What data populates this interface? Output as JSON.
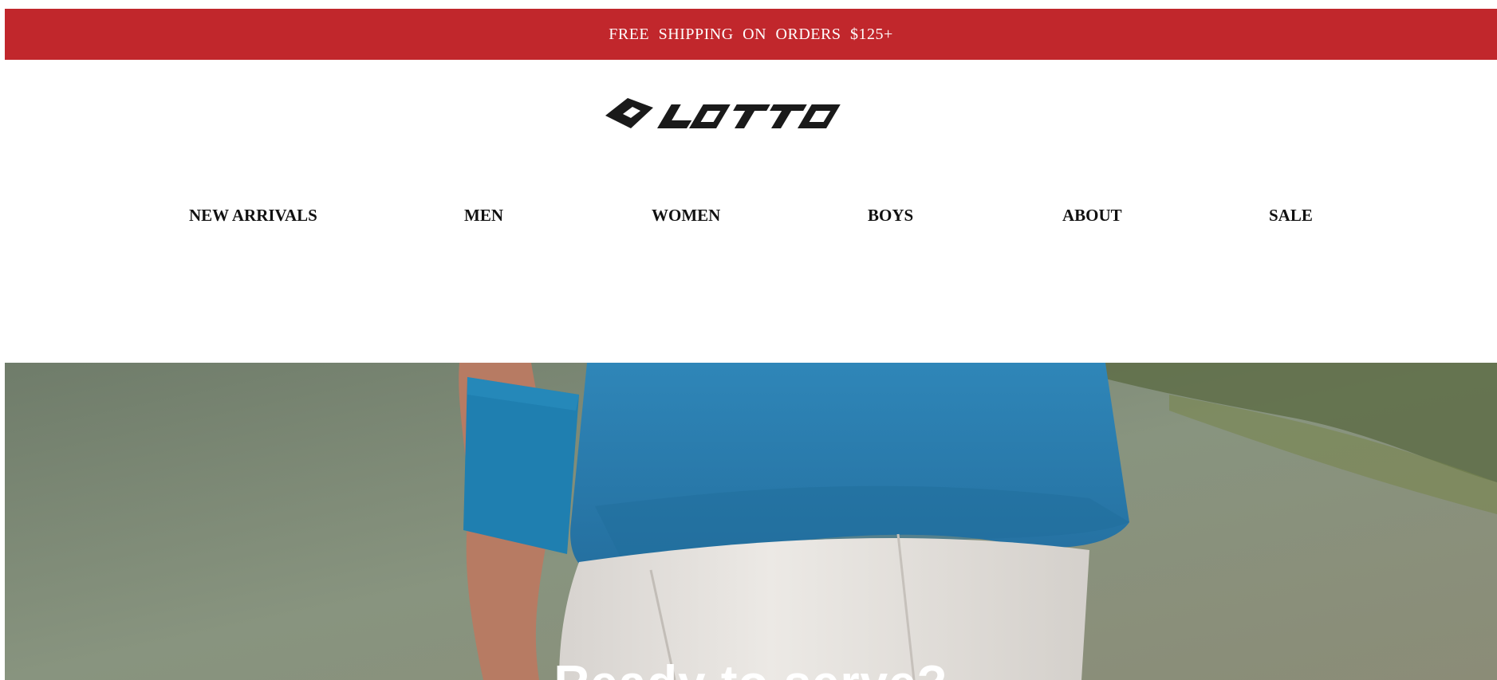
{
  "announcement": {
    "text": "FREE  SHIPPING  ON  ORDERS  $125+",
    "background_color": "#c1272c"
  },
  "header": {
    "logo": {
      "name": "lotto-logo",
      "text": "LOTTO"
    },
    "nav": [
      {
        "label": "NEW ARRIVALS"
      },
      {
        "label": "MEN"
      },
      {
        "label": "WOMEN"
      },
      {
        "label": "BOYS"
      },
      {
        "label": "ABOUT"
      },
      {
        "label": "SALE"
      }
    ]
  },
  "hero": {
    "heading": "Ready to serve?",
    "image": "tennis-player-holding-ball",
    "colors": {
      "shirt": "#2a7fb0",
      "shorts": "#e3e0dc",
      "court": "#7d8a76"
    }
  }
}
